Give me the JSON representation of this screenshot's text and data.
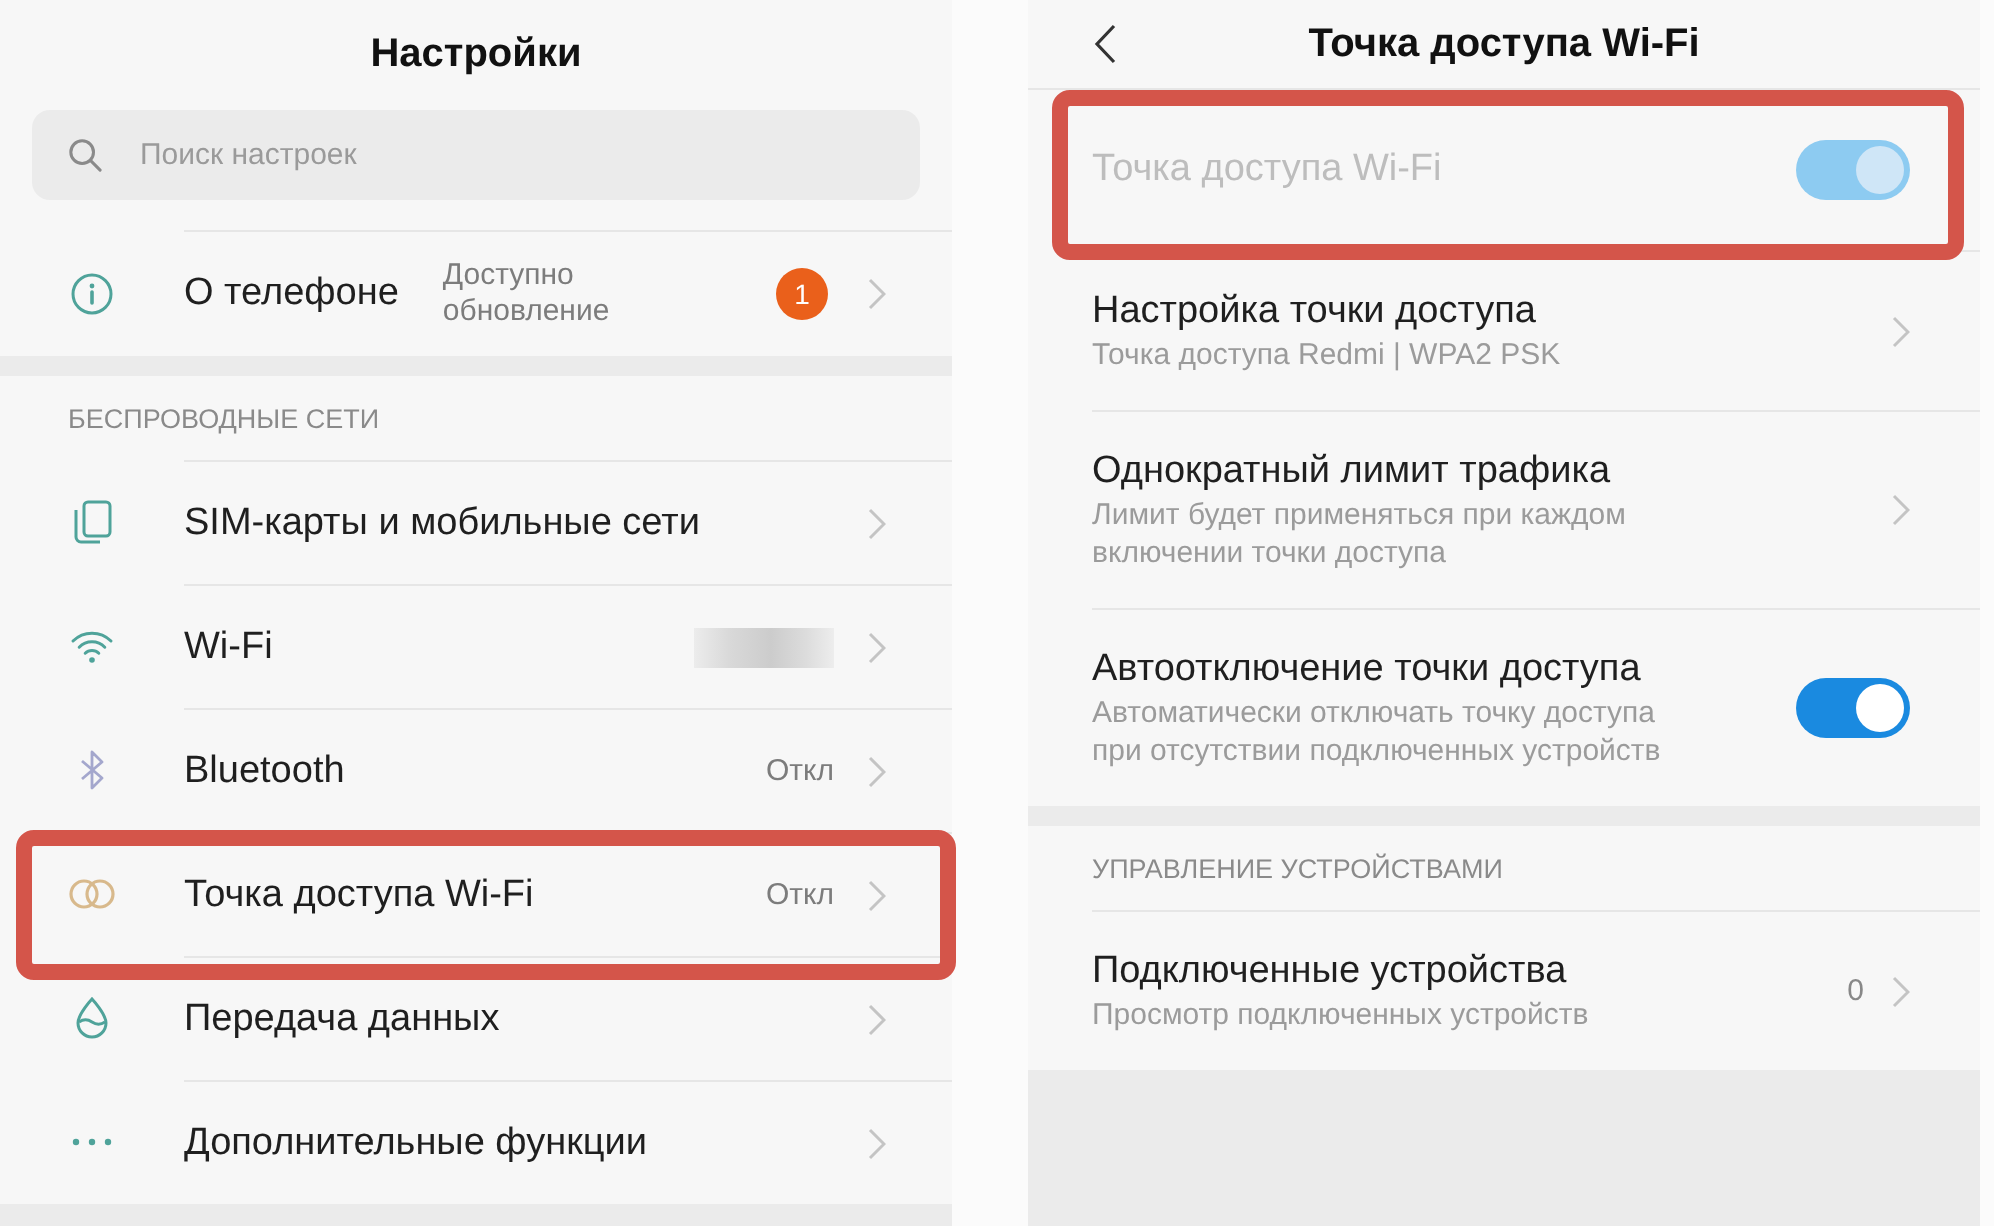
{
  "settings": {
    "title": "Настройки",
    "search": {
      "placeholder": "Поиск настроек"
    },
    "groups": [
      {
        "items": [
          {
            "label": "О телефоне",
            "value": "Доступно\nобновление",
            "badge": "1",
            "highlighted": false
          }
        ]
      },
      {
        "header": "БЕСПРОВОДНЫЕ СЕТИ",
        "items": [
          {
            "label": "SIM-карты и мобильные сети",
            "highlighted": false
          },
          {
            "label": "Wi-Fi",
            "redacted_value": true,
            "highlighted": false
          },
          {
            "label": "Bluetooth",
            "value": "Откл",
            "highlighted": false
          },
          {
            "label": "Точка доступа Wi-Fi",
            "value": "Откл",
            "highlighted": true
          },
          {
            "label": "Передача данных",
            "highlighted": false
          },
          {
            "label": "Дополнительные функции",
            "highlighted": false
          }
        ]
      }
    ]
  },
  "hotspot": {
    "title": "Точка доступа Wi-Fi",
    "groups": [
      {
        "items": [
          {
            "kind": "toggle",
            "title": "Точка доступа Wi-Fi",
            "on": true,
            "disabled": true,
            "highlighted": true
          },
          {
            "kind": "link",
            "title": "Настройка точки доступа",
            "subtitle": "Точка доступа Redmi | WPA2 PSK",
            "disabled": false,
            "highlighted": false
          },
          {
            "kind": "link",
            "title": "Однократный лимит трафика",
            "subtitle": "Лимит будет применяться при каждом\nвключении точки доступа",
            "disabled": false,
            "highlighted": false
          },
          {
            "kind": "toggle",
            "title": "Автоотключение точки доступа",
            "subtitle": "Автоматически отключать точку доступа\nпри отсутствии подключенных устройств",
            "on": true,
            "disabled": false,
            "highlighted": false
          }
        ]
      },
      {
        "header": "УПРАВЛЕНИЕ УСТРОЙСТВАМИ",
        "items": [
          {
            "kind": "link",
            "title": "Подключенные устройства",
            "subtitle": "Просмотр подключенных устройств",
            "value": "0",
            "disabled": false,
            "highlighted": false
          }
        ]
      }
    ]
  }
}
